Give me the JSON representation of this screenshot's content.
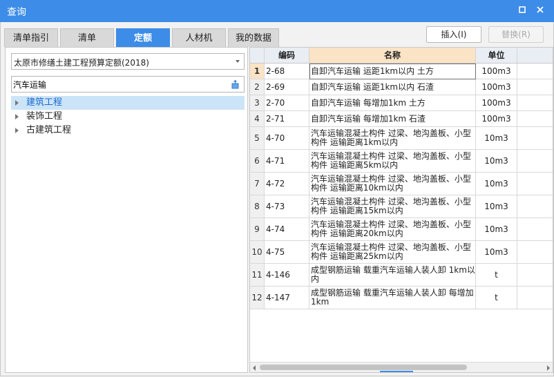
{
  "window": {
    "title": "查询"
  },
  "tabs": [
    {
      "label": "清单指引",
      "active": false
    },
    {
      "label": "清单",
      "active": false
    },
    {
      "label": "定额",
      "active": true
    },
    {
      "label": "人材机",
      "active": false
    },
    {
      "label": "我的数据",
      "active": false
    }
  ],
  "buttons": {
    "insert": "插入(I)",
    "replace": "替换(R)"
  },
  "quota_library": {
    "selected": "太原市修缮土建工程预算定额(2018)"
  },
  "search": {
    "value": "汽车运输"
  },
  "tree": [
    {
      "label": "建筑工程",
      "selected": true
    },
    {
      "label": "装饰工程",
      "selected": false
    },
    {
      "label": "古建筑工程",
      "selected": false
    }
  ],
  "table": {
    "headers": {
      "code": "编码",
      "name": "名称",
      "unit": "单位",
      "extra": "单"
    },
    "rows": [
      {
        "num": "1",
        "code": "2-68",
        "name": "自卸汽车运输 运距1km以内 土方",
        "unit": "100m3"
      },
      {
        "num": "2",
        "code": "2-69",
        "name": "自卸汽车运输 运距1km以内 石渣",
        "unit": "100m3"
      },
      {
        "num": "3",
        "code": "2-70",
        "name": "自卸汽车运输 每增加1km 土方",
        "unit": "100m3"
      },
      {
        "num": "4",
        "code": "2-71",
        "name": "自卸汽车运输 每增加1km 石渣",
        "unit": "100m3"
      },
      {
        "num": "5",
        "code": "4-70",
        "name": "汽车运输混凝土构件 过梁、地沟盖板、小型构件 运输距离1km以内",
        "unit": "10m3"
      },
      {
        "num": "6",
        "code": "4-71",
        "name": "汽车运输混凝土构件 过梁、地沟盖板、小型构件 运输距离5km以内",
        "unit": "10m3"
      },
      {
        "num": "7",
        "code": "4-72",
        "name": "汽车运输混凝土构件 过梁、地沟盖板、小型构件 运输距离10km以内",
        "unit": "10m3"
      },
      {
        "num": "8",
        "code": "4-73",
        "name": "汽车运输混凝土构件 过梁、地沟盖板、小型构件 运输距离15km以内",
        "unit": "10m3"
      },
      {
        "num": "9",
        "code": "4-74",
        "name": "汽车运输混凝土构件 过梁、地沟盖板、小型构件 运输距离20km以内",
        "unit": "10m3"
      },
      {
        "num": "10",
        "code": "4-75",
        "name": "汽车运输混凝土构件 过梁、地沟盖板、小型构件 运输距离25km以内",
        "unit": "10m3"
      },
      {
        "num": "11",
        "code": "4-146",
        "name": "成型钢筋运输 载重汽车运输人装人卸 1km以内",
        "unit": "t"
      },
      {
        "num": "12",
        "code": "4-147",
        "name": "成型钢筋运输 载重汽车运输人装人卸 每增加1km",
        "unit": "t"
      }
    ]
  }
}
